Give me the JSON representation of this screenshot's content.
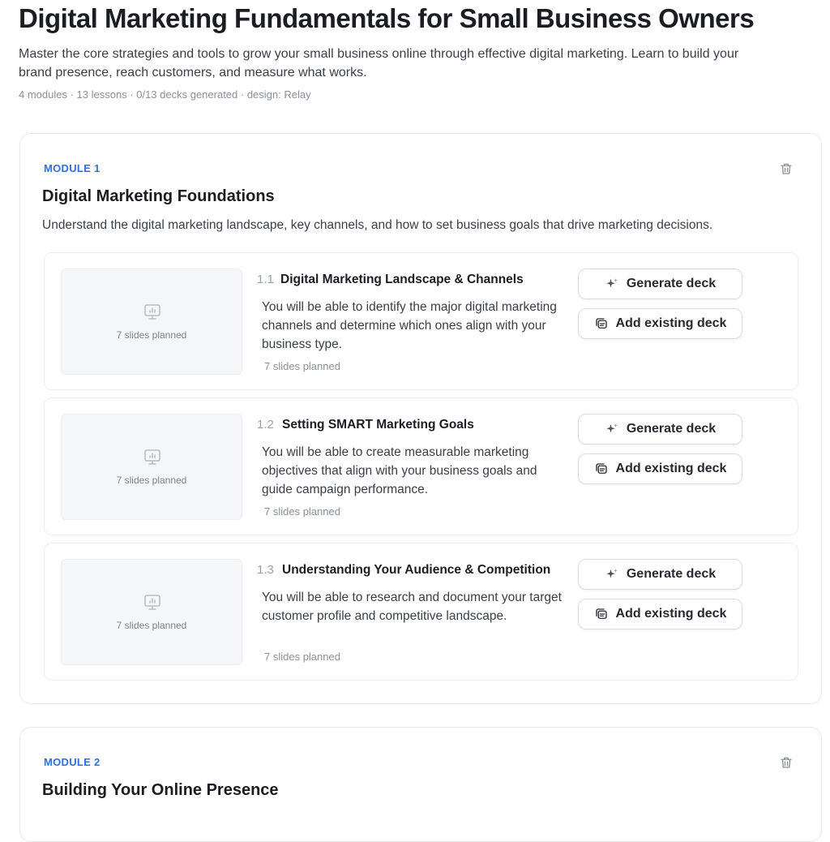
{
  "course": {
    "title": "Digital Marketing Fundamentals for Small Business Owners",
    "description": "Master the core strategies and tools to grow your small business online through effective digital marketing. Learn to build your brand presence, reach customers, and measure what works.",
    "meta": "4 modules · 13 lessons · 0/13 decks generated · design: Relay"
  },
  "modules": [
    {
      "label": "MODULE 1",
      "title": "Digital Marketing Foundations",
      "description": "Understand the digital marketing landscape, key channels, and how to set business goals that drive marketing decisions.",
      "lessons": [
        {
          "number": "1.1",
          "title": "Digital Marketing Landscape & Channels",
          "objective": "You will be able to identify the major digital marketing channels and determine which ones align with your business type.",
          "slides": "7 slides planned",
          "thumb_label": "7 slides planned"
        },
        {
          "number": "1.2",
          "title": "Setting SMART Marketing Goals",
          "objective": "You will be able to create measurable marketing objectives that align with your business goals and guide campaign performance.",
          "slides": "7 slides planned",
          "thumb_label": "7 slides planned"
        },
        {
          "number": "1.3",
          "title": "Understanding Your Audience & Competition",
          "objective": "You will be able to research and document your target customer profile and competitive landscape.",
          "slides": "7 slides planned",
          "thumb_label": "7 slides planned"
        }
      ]
    },
    {
      "label": "MODULE 2",
      "title": "Building Your Online Presence"
    }
  ],
  "buttons": {
    "generate": "Generate deck",
    "add_existing": "Add existing deck"
  },
  "icons": {
    "delete": "trash-icon",
    "generate": "sparkle-icon",
    "add": "copy-deck-icon",
    "thumb": "presentation-icon"
  },
  "colors": {
    "accent": "#2f6fe0",
    "border": "#e6e8eb"
  }
}
